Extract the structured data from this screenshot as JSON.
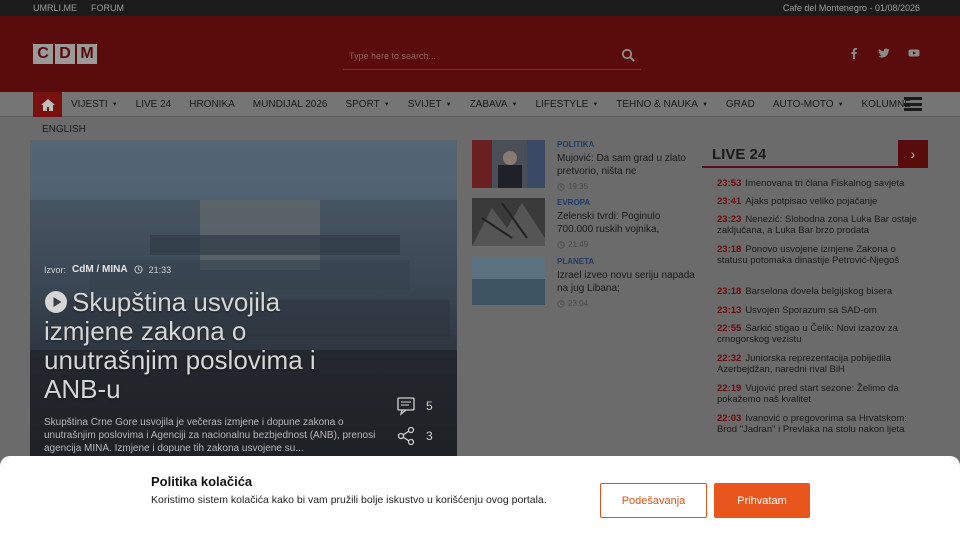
{
  "topbar": {
    "links": [
      "UMRLI.ME",
      "FORUM"
    ],
    "date_text": "Cafe del Montenegro - 01/08/2026"
  },
  "header": {
    "logo_letters": [
      "C",
      "D",
      "M"
    ],
    "search_placeholder": "Type here to search...",
    "social_icons": [
      "facebook-icon",
      "twitter-icon",
      "youtube-icon"
    ]
  },
  "nav": {
    "items": [
      {
        "label": "VIJESTI",
        "dropdown": true
      },
      {
        "label": "LIVE 24",
        "dropdown": false
      },
      {
        "label": "HRONIKA",
        "dropdown": false
      },
      {
        "label": "MUNDIJAL 2026",
        "dropdown": false
      },
      {
        "label": "SPORT",
        "dropdown": true
      },
      {
        "label": "SVIJET",
        "dropdown": true
      },
      {
        "label": "ZABAVA",
        "dropdown": true
      },
      {
        "label": "LIFESTYLE",
        "dropdown": true
      },
      {
        "label": "TEHNO & NAUKA",
        "dropdown": true
      },
      {
        "label": "GRAD",
        "dropdown": false
      },
      {
        "label": "AUTO-MOTO",
        "dropdown": true
      },
      {
        "label": "KOLUMNE",
        "dropdown": false
      }
    ],
    "sub_item": "ENGLISH"
  },
  "hero": {
    "source_label": "Izvor:",
    "source": "CdM / MINA",
    "time": "21:33",
    "title": "Skupština usvojila izmjene zakona o unutrašnjim poslovima i ANB-u",
    "excerpt": "Skupština Crne Gore usvojila je večeras izmjene i dopune zakona o unutrašnjim poslovima i Agenciji za nacionalnu bezbjednost (ANB), prenosi agencija MINA. Izmjene i dopune tih zakona usvojene su...",
    "comments": "5",
    "shares": "3"
  },
  "side_articles": [
    {
      "category": "POLITIKA",
      "title": "Mujović: Da sam grad u zlato pretvorio, ništa ne",
      "time": "19:35"
    },
    {
      "category": "EVROPA",
      "title": "Zelenski tvrdi: Poginulo 700.000 ruskih vojnika,",
      "time": "21:49"
    },
    {
      "category": "PLANETA",
      "title": "Izrael izveo novu seriju napada na jug Libana;",
      "time": "23:04"
    }
  ],
  "live24": {
    "title": "LIVE 24",
    "items": [
      {
        "time": "23:53",
        "text": "Imenovana tri člana Fiskalnog savjeta"
      },
      {
        "time": "23:41",
        "text": "Ajaks potpisao veliko pojačanje"
      },
      {
        "time": "23:23",
        "text": "Nenezić: Slobodna zona Luka Bar ostaje zaključana, a Luka Bar brzo prodata"
      },
      {
        "time": "23:18",
        "text": "Ponovo usvojene izmjene Zakona o statusu potomaka dinastije Petrović-Njegoš"
      },
      {
        "time": "23:18",
        "text": "Barselona dovela belgijskog bisera"
      },
      {
        "time": "23:13",
        "text": "Usvojen Sporazum sa SAD-om"
      },
      {
        "time": "22:55",
        "text": "Sarkić stigao u Čelik: Novi izazov za crnogorskog vezistu"
      },
      {
        "time": "22:32",
        "text": "Juniorska reprezentacija pobijedila Azerbejdžan, naredni rival BiH"
      },
      {
        "time": "22:19",
        "text": "Vujović pred start sezone: Želimo da pokažemo naš kvalitet"
      },
      {
        "time": "22:03",
        "text": "Ivanović o pregovorima sa Hrvatskom: Brod \"Jadran\" i Prevlaka na stolu nakon ljeta"
      }
    ]
  },
  "cookie": {
    "title": "Politika kolačića",
    "text": "Koristimo sistem kolačića kako bi vam pružili bolje iskustvo u korišćenju ovog portala.",
    "settings_label": "Podešavanja",
    "accept_label": "Prihvatam"
  }
}
